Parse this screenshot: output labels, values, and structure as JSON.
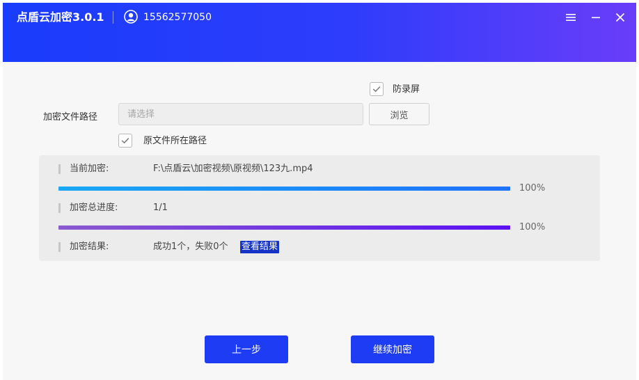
{
  "app": {
    "title": "点盾云加密3.0.1",
    "user_phone": "15562577050"
  },
  "options": {
    "anti_record_label": "防录屏",
    "anti_record_checked": true,
    "path_label": "加密文件路径",
    "path_placeholder": "请选择",
    "browse_label": "浏览",
    "original_path_label": "原文件所在路径",
    "original_path_checked": true
  },
  "progress": {
    "current_label": "当前加密:",
    "current_file": "F:\\点盾云\\加密视频\\原视频\\123九.mp4",
    "current_percent_text": "100%",
    "current_fraction": 1.0,
    "total_label": "加密总进度:",
    "total_value": "1/1",
    "total_percent_text": "100%",
    "total_fraction": 1.0,
    "result_label": "加密结果:",
    "result_value": "成功1个，失败0个",
    "view_result_label": "查看结果"
  },
  "actions": {
    "prev_label": "上一步",
    "next_label": "继续加密"
  },
  "colors": {
    "titlebar_start": "#1a3cfb",
    "titlebar_end": "#6a3df9",
    "primary_button": "#1e3cf3",
    "view_result_bg": "#1533c6"
  }
}
